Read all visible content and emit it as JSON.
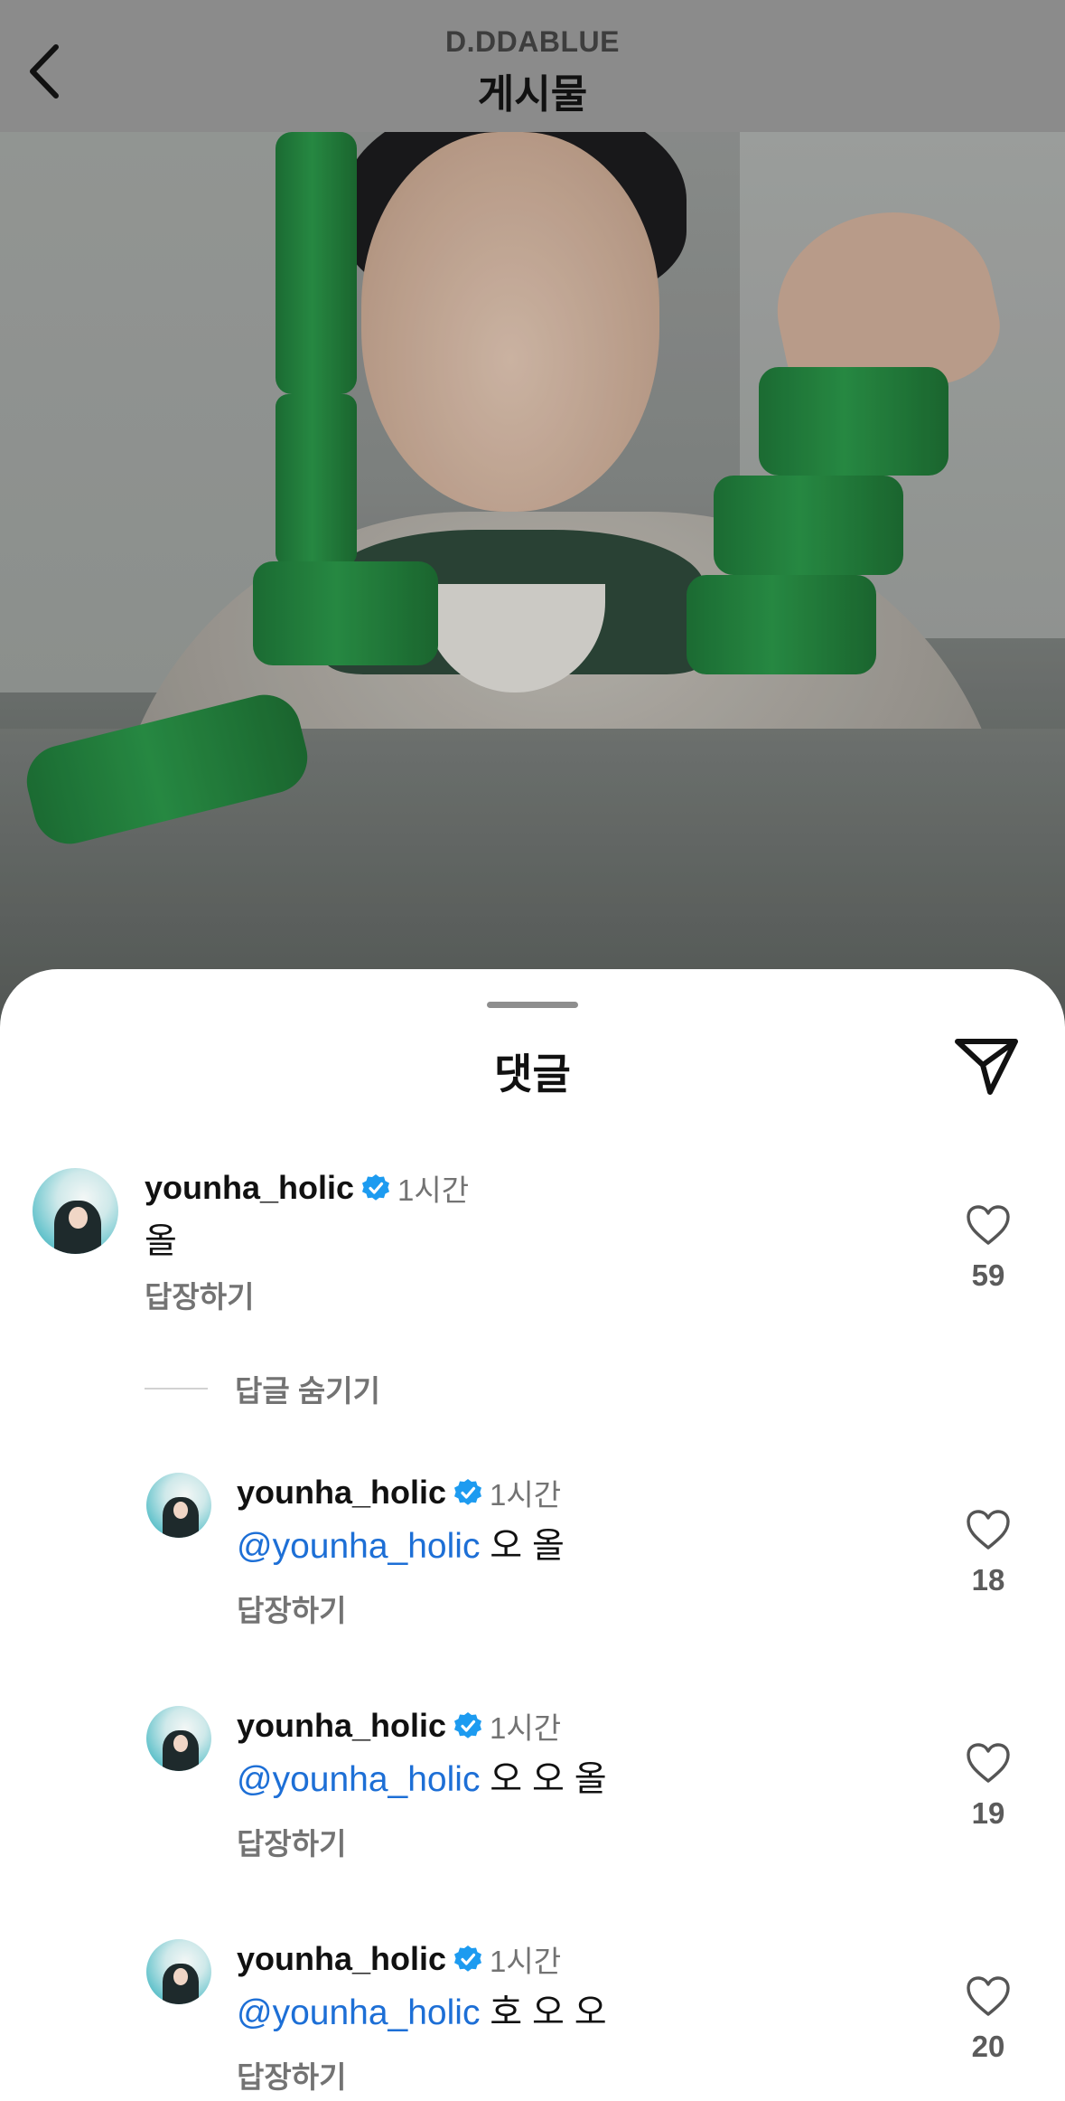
{
  "header": {
    "account": "D.DDABLUE",
    "title": "게시물",
    "back_icon": "chevron-left-icon"
  },
  "sheet": {
    "title": "댓글",
    "share_icon": "paper-plane-icon"
  },
  "comments": [
    {
      "username": "younha_holic",
      "verified": true,
      "time": "1시간",
      "mention": "",
      "text": "올",
      "reply_label": "답장하기",
      "likes": "59"
    }
  ],
  "hide_replies_label": "답글 숨기기",
  "replies": [
    {
      "username": "younha_holic",
      "time": "1시간",
      "mention": "@younha_holic",
      "text": " 오 올",
      "reply_label": "답장하기",
      "likes": "18"
    },
    {
      "username": "younha_holic",
      "time": "1시간",
      "mention": "@younha_holic",
      "text": " 오 오 올",
      "reply_label": "답장하기",
      "likes": "19"
    },
    {
      "username": "younha_holic",
      "time": "1시간",
      "mention": "@younha_holic",
      "text": " 호 오 오",
      "reply_label": "답장하기",
      "likes": "20"
    }
  ],
  "colors": {
    "verified_badge": "#1d9bf0",
    "mention": "#1d6fd6",
    "product_green": "#2c9b4b"
  }
}
